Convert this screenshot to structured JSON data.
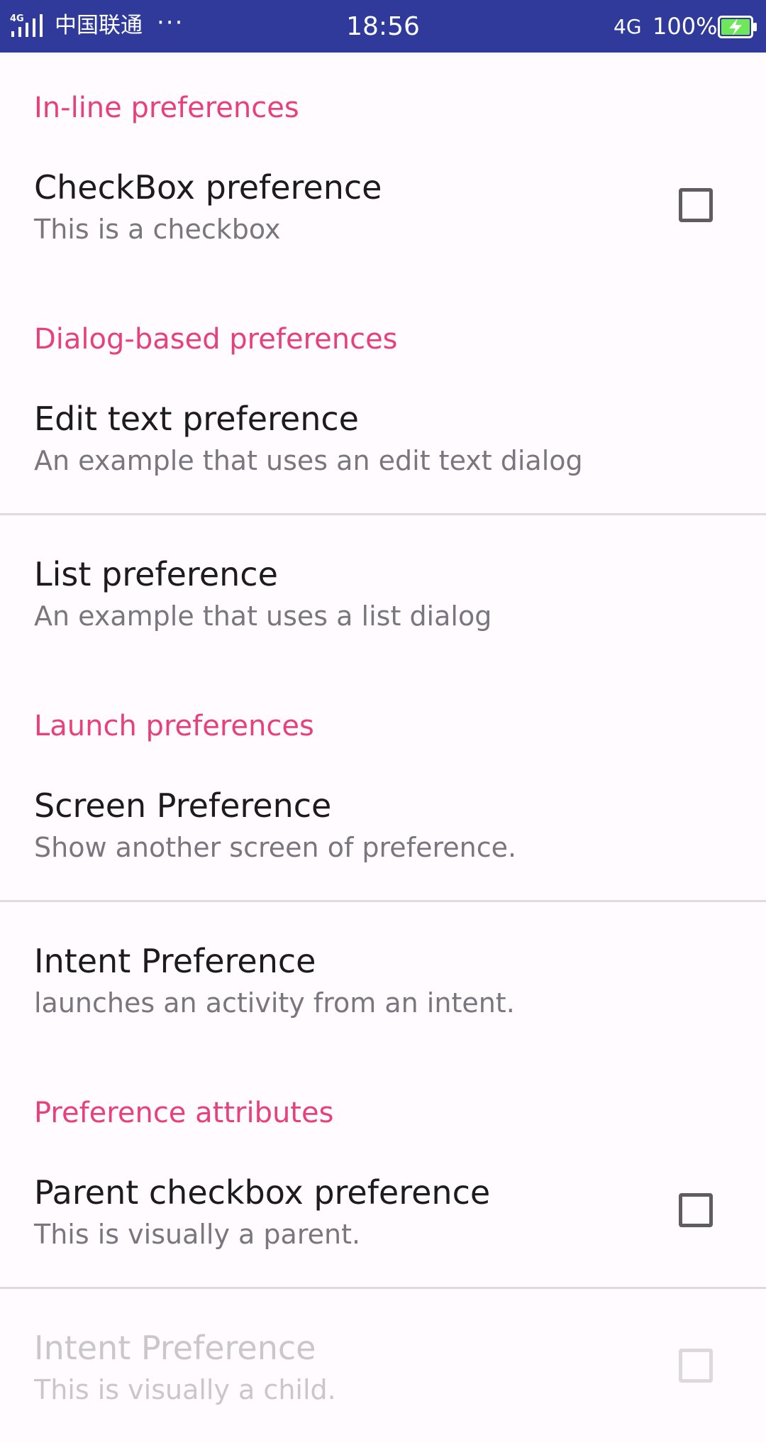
{
  "status_bar": {
    "signal_label": "4G",
    "carrier": "中国联通",
    "more": "···",
    "time": "18:56",
    "network": "4G",
    "battery_percent": "100%",
    "background_color": "#303a9b",
    "battery_color": "#6ee85a"
  },
  "accent_color": "#e8407d",
  "categories": {
    "inline": "In-line preferences",
    "dialog": "Dialog-based preferences",
    "launch": "Launch preferences",
    "attributes": "Preference attributes"
  },
  "prefs": {
    "checkbox": {
      "title": "CheckBox preference",
      "summary": "This is a checkbox",
      "checked": false
    },
    "edit_text": {
      "title": "Edit text preference",
      "summary": "An example that uses an edit text dialog"
    },
    "list": {
      "title": "List preference",
      "summary": "An example that uses a list dialog"
    },
    "screen": {
      "title": "Screen Preference",
      "summary": "Show another screen of preference."
    },
    "intent": {
      "title": "Intent Preference",
      "summary": "launches an activity from an intent."
    },
    "parent_checkbox": {
      "title": "Parent checkbox preference",
      "summary": "This is visually a parent.",
      "checked": false
    },
    "child_checkbox": {
      "title": "Intent Preference",
      "summary": "This is visually a child.",
      "checked": false,
      "enabled": false
    }
  }
}
